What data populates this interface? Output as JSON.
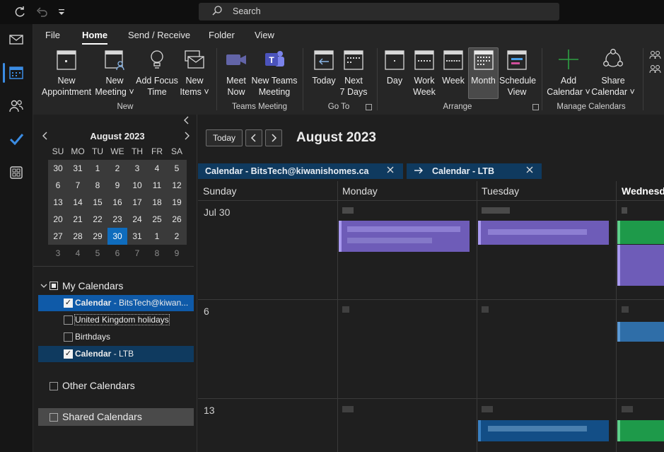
{
  "titlebar": {
    "search_placeholder": "Search",
    "icons": [
      "sync-icon",
      "undo-icon",
      "customize-toolbar-icon",
      "search-icon"
    ]
  },
  "navrail": {
    "items": [
      "mail-icon",
      "calendar-icon",
      "people-icon",
      "todo-icon",
      "apps-icon"
    ],
    "active": "calendar-icon"
  },
  "ribbon": {
    "tabs": [
      "File",
      "Home",
      "Send / Receive",
      "Folder",
      "View"
    ],
    "active_tab": "Home",
    "buttons": {
      "new_appointment": [
        "New",
        "Appointment"
      ],
      "new_meeting": [
        "New",
        "Meeting ˅"
      ],
      "add_focus_time": [
        "Add Focus",
        "Time"
      ],
      "new_items": [
        "New",
        "Items ˅"
      ],
      "meet_now": [
        "Meet",
        "Now"
      ],
      "new_teams_meeting": [
        "New Teams",
        "Meeting"
      ],
      "today": [
        "Today",
        ""
      ],
      "next_7_days": [
        "Next",
        "7 Days"
      ],
      "day": [
        "Day",
        ""
      ],
      "work_week": [
        "Work",
        "Week"
      ],
      "week": [
        "Week",
        ""
      ],
      "month": [
        "Month",
        ""
      ],
      "schedule_view": [
        "Schedule",
        "View"
      ],
      "add_calendar": [
        "Add",
        "Calendar ˅"
      ],
      "share_calendar": [
        "Share",
        "Calendar ˅"
      ]
    },
    "groups": [
      "New",
      "Teams Meeting",
      "Go To",
      "Arrange",
      "Manage Calendars"
    ],
    "selected_view": "Month"
  },
  "mini_calendar": {
    "title": "August 2023",
    "weekdays": [
      "SU",
      "MO",
      "TU",
      "WE",
      "TH",
      "FR",
      "SA"
    ],
    "weeks": [
      [
        "30",
        "31",
        "1",
        "2",
        "3",
        "4",
        "5"
      ],
      [
        "6",
        "7",
        "8",
        "9",
        "10",
        "11",
        "12"
      ],
      [
        "13",
        "14",
        "15",
        "16",
        "17",
        "18",
        "19"
      ],
      [
        "20",
        "21",
        "22",
        "23",
        "24",
        "25",
        "26"
      ],
      [
        "27",
        "28",
        "29",
        "30",
        "31",
        "1",
        "2"
      ],
      [
        "3",
        "4",
        "5",
        "6",
        "7",
        "8",
        "9"
      ]
    ],
    "today": "30"
  },
  "folders": {
    "my_calendars_label": "My Calendars",
    "items": [
      {
        "bold": "Calendar",
        "rest": " - BitsTech@kiwan...",
        "checked": true
      },
      {
        "bold": "",
        "rest": "United Kingdom holidays",
        "checked": false
      },
      {
        "bold": "",
        "rest": "Birthdays",
        "checked": false
      },
      {
        "bold": "Calendar",
        "rest": " - LTB",
        "checked": true
      }
    ],
    "other_calendars_label": "Other Calendars",
    "shared_calendars_label": "Shared Calendars"
  },
  "main": {
    "today_button": "Today",
    "month_title": "August 2023",
    "tabs": [
      {
        "label": "Calendar - BitsTech@kiwanishomes.ca"
      },
      {
        "label": "Calendar - LTB"
      }
    ],
    "day_headers": [
      "Sunday",
      "Monday",
      "Tuesday",
      "Wednesd"
    ],
    "week_labels": [
      "Jul 30",
      "6",
      "13"
    ]
  },
  "colors": {
    "accent": "#0f6cbd",
    "tab_bg": "#0f3a5f",
    "event_purple": "#7b68c9",
    "event_green": "#1e9a4a",
    "event_blue": "#2f6ea8"
  }
}
